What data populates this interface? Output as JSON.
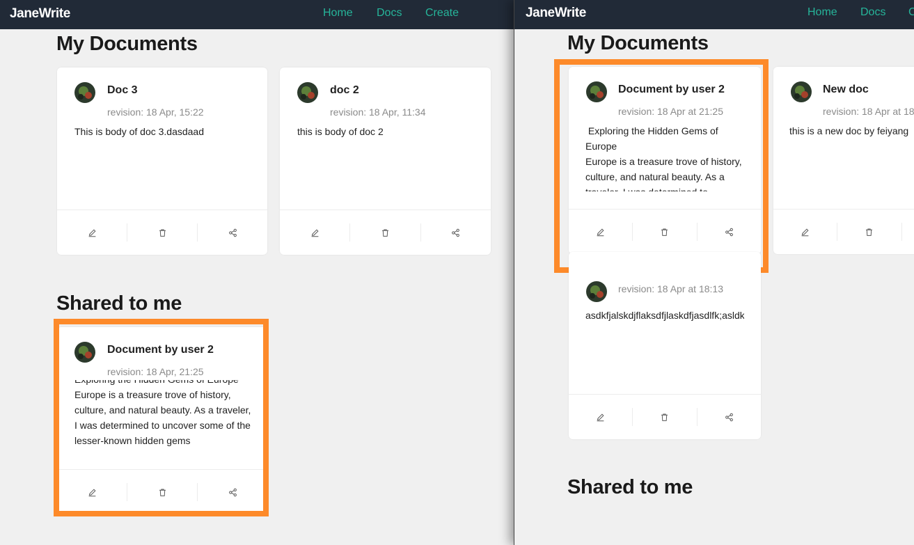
{
  "left_window": {
    "nav": {
      "brand": "JaneWrite",
      "links": [
        "Home",
        "Docs",
        "Create"
      ]
    },
    "my_documents_title": "My Documents",
    "documents": [
      {
        "title": "Doc 3",
        "revision": "revision: 18 Apr, 15:22",
        "body": [
          "This is body of doc 3.dasdaad"
        ]
      },
      {
        "title": "doc 2",
        "revision": "revision: 18 Apr, 11:34",
        "body": [
          "this is body of doc 2"
        ]
      }
    ],
    "shared_title": "Shared to me",
    "shared": [
      {
        "title": "Document by user 2",
        "revision": "revision: 18 Apr, 21:25",
        "body": [
          "Exploring the Hidden Gems of Europe",
          "Europe is a treasure trove of history, culture, and natural beauty. As a traveler, I was determined to uncover some of the lesser-known hidden gems"
        ]
      }
    ]
  },
  "right_window": {
    "nav": {
      "brand": "JaneWrite",
      "links": [
        "Home",
        "Docs",
        "C"
      ]
    },
    "my_documents_title": "My Documents",
    "documents": [
      {
        "title": "Document by user 2",
        "revision": "revision: 18 Apr at 21:25",
        "body": [
          " Exploring the Hidden Gems of Europe",
          "Europe is a treasure trove of history, culture, and natural beauty. As a traveler, I was determined to"
        ]
      },
      {
        "title": "New doc",
        "revision": "revision: 18 Apr at 18",
        "body": [
          "this is a new doc by feiyang"
        ]
      },
      {
        "title": "",
        "revision": "revision: 18 Apr at 18:13",
        "body": [
          "asdkfjalskdjflaksdfjlaskdfjasdlfk;asldkfj"
        ]
      }
    ],
    "shared_title": "Shared to me"
  },
  "icons": {
    "edit": "pencil-icon",
    "delete": "trash-icon",
    "share": "share-icon"
  },
  "colors": {
    "nav_bg": "#212a37",
    "nav_link": "#26b59a",
    "highlight": "#fd8a2a",
    "page_bg": "#f0f0f0"
  }
}
